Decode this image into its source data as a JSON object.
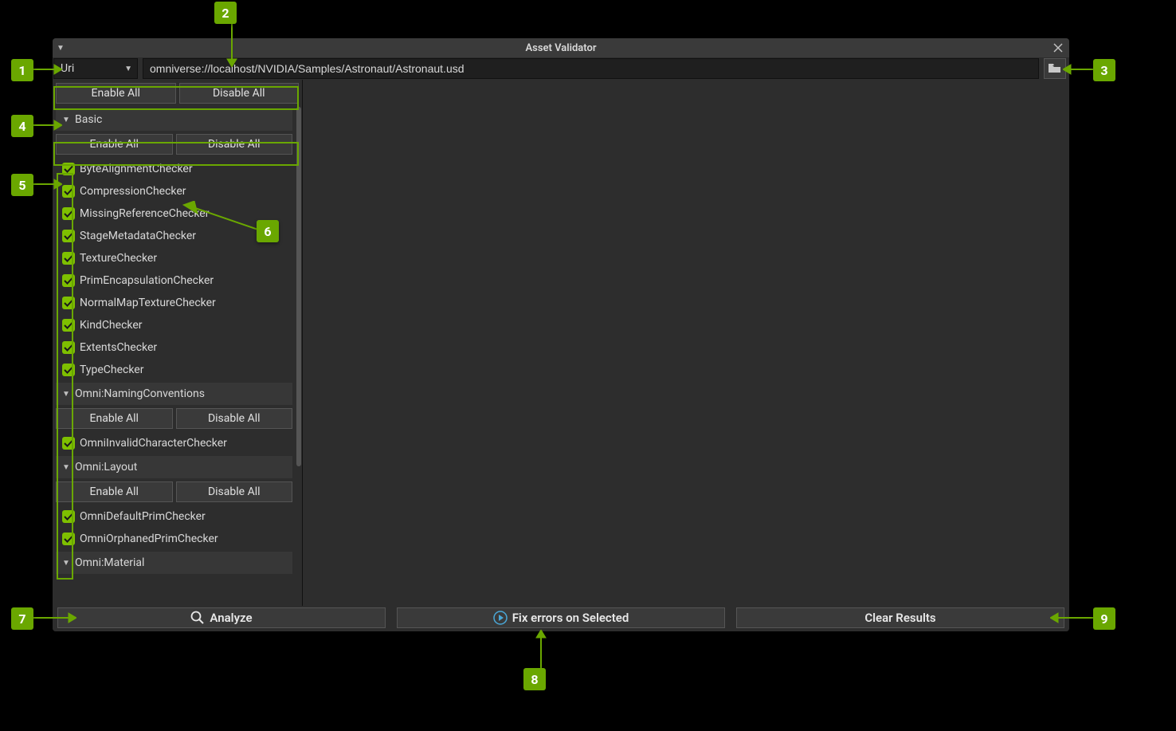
{
  "window": {
    "title": "Asset Validator"
  },
  "uri": {
    "mode": "Uri",
    "value": "omniverse://localhost/NVIDIA/Samples/Astronaut/Astronaut.usd"
  },
  "buttons": {
    "enable_all": "Enable All",
    "disable_all": "Disable All"
  },
  "sections": {
    "basic": {
      "title": "Basic",
      "checkers": [
        "ByteAlignmentChecker",
        "CompressionChecker",
        "MissingReferenceChecker",
        "StageMetadataChecker",
        "TextureChecker",
        "PrimEncapsulationChecker",
        "NormalMapTextureChecker",
        "KindChecker",
        "ExtentsChecker",
        "TypeChecker"
      ]
    },
    "naming": {
      "title": "Omni:NamingConventions",
      "checkers": [
        "OmniInvalidCharacterChecker"
      ]
    },
    "layout": {
      "title": "Omni:Layout",
      "checkers": [
        "OmniDefaultPrimChecker",
        "OmniOrphanedPrimChecker"
      ]
    },
    "material": {
      "title": "Omni:Material"
    }
  },
  "footer": {
    "analyze": "Analyze",
    "fix": "Fix errors on Selected",
    "clear": "Clear Results"
  },
  "callouts": [
    "1",
    "2",
    "3",
    "4",
    "5",
    "6",
    "7",
    "8",
    "9"
  ]
}
